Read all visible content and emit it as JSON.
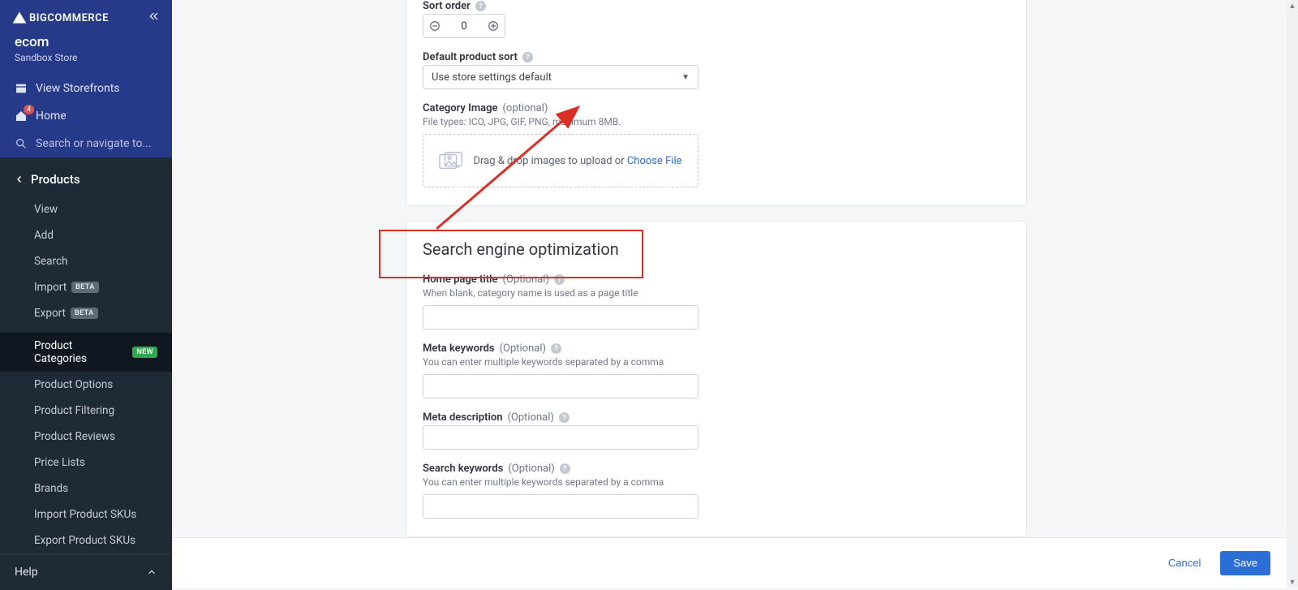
{
  "brand": "BIGCOMMERCE",
  "store": {
    "name": "ecom",
    "sub": "Sandbox Store"
  },
  "nav": {
    "view_storefronts": "View Storefronts",
    "home": "Home",
    "home_badge": "4",
    "search_placeholder": "Search or navigate to..."
  },
  "section": {
    "title": "Products",
    "items": [
      {
        "label": "View"
      },
      {
        "label": "Add"
      },
      {
        "label": "Search"
      },
      {
        "label": "Import",
        "pill": "BETA"
      },
      {
        "label": "Export",
        "pill": "BETA"
      }
    ],
    "items2": [
      {
        "label": "Product Categories",
        "pill": "NEW",
        "pill_new": true,
        "active": true
      },
      {
        "label": "Product Options"
      },
      {
        "label": "Product Filtering"
      },
      {
        "label": "Product Reviews"
      },
      {
        "label": "Price Lists"
      },
      {
        "label": "Brands"
      },
      {
        "label": "Import Product SKUs"
      },
      {
        "label": "Export Product SKUs"
      }
    ]
  },
  "help": "Help",
  "form": {
    "sort_order": {
      "label": "Sort order",
      "value": "0"
    },
    "default_sort": {
      "label": "Default product sort",
      "value": "Use store settings default"
    },
    "cat_image": {
      "label": "Category Image",
      "optional": "(optional)",
      "hint": "File types: ICO, JPG, GIF, PNG, maximum 8MB.",
      "drop": "Drag & drop images to upload or ",
      "choose": "Choose File"
    },
    "seo_title": "Search engine optimization",
    "home_title": {
      "label": "Home page title",
      "optional": "(Optional)",
      "hint": "When blank, category name is used as a page title"
    },
    "meta_kw": {
      "label": "Meta keywords",
      "optional": "(Optional)",
      "hint": "You can enter multiple keywords separated by a comma"
    },
    "meta_desc": {
      "label": "Meta description",
      "optional": "(Optional)"
    },
    "search_kw": {
      "label": "Search keywords",
      "optional": "(Optional)",
      "hint": "You can enter multiple keywords separated by a comma"
    }
  },
  "footer": {
    "cancel": "Cancel",
    "save": "Save"
  }
}
